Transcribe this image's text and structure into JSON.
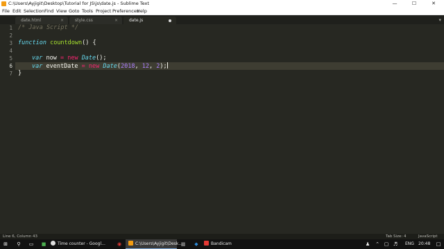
{
  "window": {
    "title": "C:\\Users\\Ayjigit\\Desktop\\Tutorial for JS\\js\\date.js - Sublime Text"
  },
  "menu": [
    "File",
    "Edit",
    "Selection",
    "Find",
    "View",
    "Goto",
    "Tools",
    "Project",
    "Preferences",
    "Help"
  ],
  "tabs": [
    {
      "label": "date.html",
      "active": false,
      "modified": false
    },
    {
      "label": "style.css",
      "active": false,
      "modified": false
    },
    {
      "label": "date.js",
      "active": true,
      "modified": true
    }
  ],
  "tab_close_glyph": "×",
  "editor": {
    "line_numbers": [
      "1",
      "2",
      "3",
      "4",
      "5",
      "6",
      "7"
    ],
    "current_line": 6,
    "code": {
      "l1_comment": "/* Java Script */",
      "l3_kw": "function",
      "l3_name": "countdown",
      "l3_rest": "() {",
      "l5_var": "var",
      "l5_ident": " now ",
      "l5_eq": "=",
      "l5_new": "new",
      "l5_type": "Date",
      "l5_end": "();",
      "l6_var": "var",
      "l6_ident": " eventDate ",
      "l6_eq": "=",
      "l6_new": "new",
      "l6_type": "Date",
      "l6_open": "(",
      "l6_n1": "2018",
      "l6_c1": ", ",
      "l6_n2": "12",
      "l6_c2": ", ",
      "l6_n3": "2",
      "l6_end": ");",
      "l7_close": "}"
    }
  },
  "status": {
    "position": "Line 6, Column 43",
    "tab_size": "Tab Size: 4",
    "syntax": "JavaScript"
  },
  "taskbar": {
    "items": [
      {
        "label": "Time counter - Googl..."
      },
      {
        "label": "C:\\Users\\Ayjigit\\Desk..."
      },
      {
        "label": "Bandicam"
      }
    ],
    "language": "ENG",
    "time": "20:48"
  },
  "colors": {
    "editor_bg": "#272822",
    "keyword": "#66d9ef",
    "function_name": "#a6e22e",
    "operator": "#f92672",
    "number": "#ae81ff",
    "comment": "#75715e"
  }
}
